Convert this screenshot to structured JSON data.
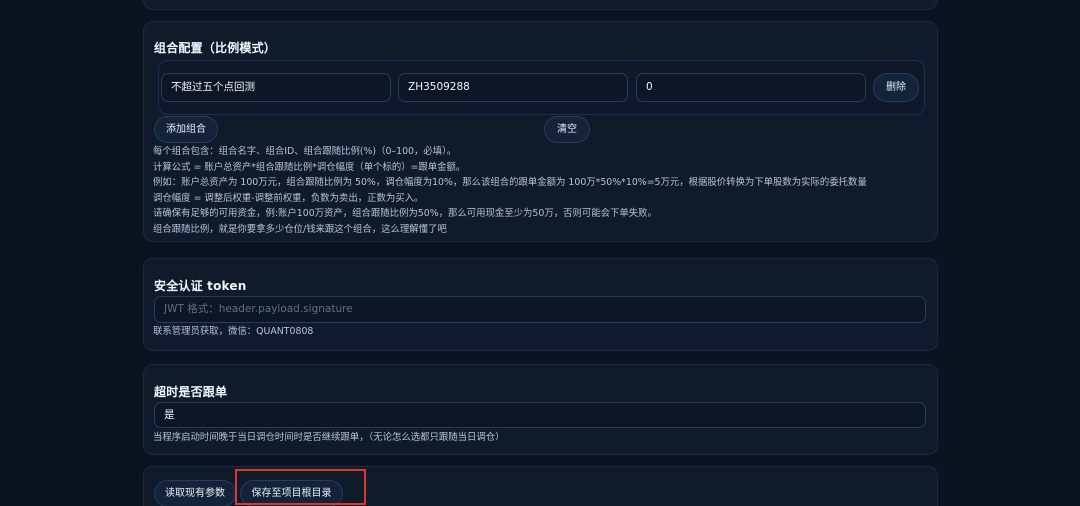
{
  "portfolio_section": {
    "title": "组合配置（比例模式）",
    "row": {
      "name_value": "不超过五个点回测",
      "id_value": "ZH3509288",
      "ratio_value": "0",
      "delete_label": "删除"
    },
    "add_label": "添加组合",
    "clear_label": "清空",
    "help_lines": [
      "每个组合包含：组合名字、组合ID、组合跟随比例(%)（0–100，必填）。",
      "计算公式 = 账户总资产*组合跟随比例*调仓幅度（单个标的）=跟单金额。",
      "例如：账户总资产为 100万元，组合跟随比例为 50%，调仓幅度为10%，那么该组合的跟单金额为 100万*50%*10%=5万元，根据股价转换为下单股数为实际的委托数量",
      "调仓幅度 = 调整后权重-调整前权重，负数为卖出，正数为买入。",
      "请确保有足够的可用资金，例:账户100万资产，组合跟随比例为50%，那么可用现金至少为50万，否则可能会下单失败。",
      "组合跟随比例，就是你要拿多少仓位/钱来跟这个组合，这么理解懂了吧"
    ]
  },
  "token_section": {
    "title": "安全认证 token",
    "placeholder": "JWT 格式：header.payload.signature",
    "help": "联系管理员获取，微信：QUANT0808"
  },
  "timeout_section": {
    "title": "超时是否跟单",
    "value": "是",
    "help": "当程序启动时间晚于当日调仓时间时是否继续跟单，（无论怎么选都只跟随当日调仓）"
  },
  "actions": {
    "read_label": "读取现有参数",
    "save_label": "保存至项目根目录"
  },
  "colors": {
    "background": "#0b1220",
    "card": "#0f1a2b",
    "highlight": "#e0342e"
  }
}
